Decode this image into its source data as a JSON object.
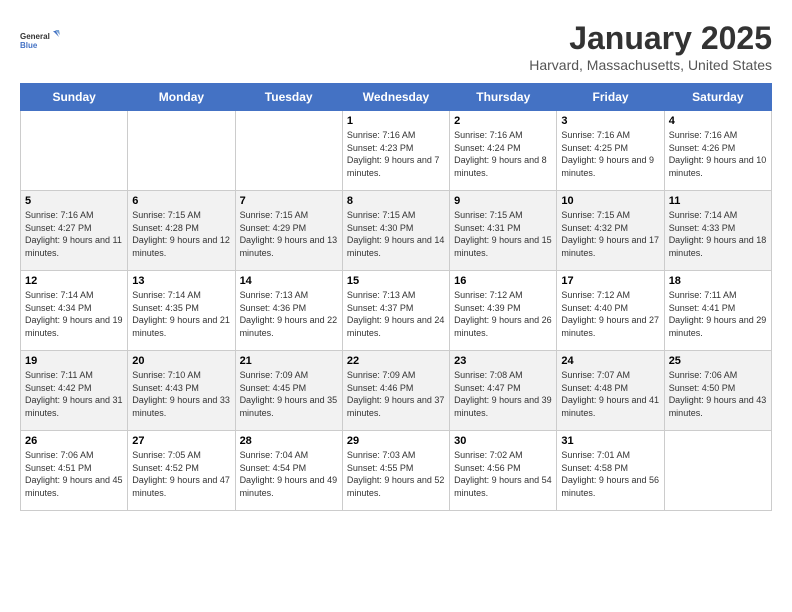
{
  "header": {
    "logo_line1": "General",
    "logo_line2": "Blue",
    "month_title": "January 2025",
    "location": "Harvard, Massachusetts, United States"
  },
  "days_of_week": [
    "Sunday",
    "Monday",
    "Tuesday",
    "Wednesday",
    "Thursday",
    "Friday",
    "Saturday"
  ],
  "weeks": [
    [
      {
        "day": "",
        "info": ""
      },
      {
        "day": "",
        "info": ""
      },
      {
        "day": "",
        "info": ""
      },
      {
        "day": "1",
        "info": "Sunrise: 7:16 AM\nSunset: 4:23 PM\nDaylight: 9 hours and 7 minutes."
      },
      {
        "day": "2",
        "info": "Sunrise: 7:16 AM\nSunset: 4:24 PM\nDaylight: 9 hours and 8 minutes."
      },
      {
        "day": "3",
        "info": "Sunrise: 7:16 AM\nSunset: 4:25 PM\nDaylight: 9 hours and 9 minutes."
      },
      {
        "day": "4",
        "info": "Sunrise: 7:16 AM\nSunset: 4:26 PM\nDaylight: 9 hours and 10 minutes."
      }
    ],
    [
      {
        "day": "5",
        "info": "Sunrise: 7:16 AM\nSunset: 4:27 PM\nDaylight: 9 hours and 11 minutes."
      },
      {
        "day": "6",
        "info": "Sunrise: 7:15 AM\nSunset: 4:28 PM\nDaylight: 9 hours and 12 minutes."
      },
      {
        "day": "7",
        "info": "Sunrise: 7:15 AM\nSunset: 4:29 PM\nDaylight: 9 hours and 13 minutes."
      },
      {
        "day": "8",
        "info": "Sunrise: 7:15 AM\nSunset: 4:30 PM\nDaylight: 9 hours and 14 minutes."
      },
      {
        "day": "9",
        "info": "Sunrise: 7:15 AM\nSunset: 4:31 PM\nDaylight: 9 hours and 15 minutes."
      },
      {
        "day": "10",
        "info": "Sunrise: 7:15 AM\nSunset: 4:32 PM\nDaylight: 9 hours and 17 minutes."
      },
      {
        "day": "11",
        "info": "Sunrise: 7:14 AM\nSunset: 4:33 PM\nDaylight: 9 hours and 18 minutes."
      }
    ],
    [
      {
        "day": "12",
        "info": "Sunrise: 7:14 AM\nSunset: 4:34 PM\nDaylight: 9 hours and 19 minutes."
      },
      {
        "day": "13",
        "info": "Sunrise: 7:14 AM\nSunset: 4:35 PM\nDaylight: 9 hours and 21 minutes."
      },
      {
        "day": "14",
        "info": "Sunrise: 7:13 AM\nSunset: 4:36 PM\nDaylight: 9 hours and 22 minutes."
      },
      {
        "day": "15",
        "info": "Sunrise: 7:13 AM\nSunset: 4:37 PM\nDaylight: 9 hours and 24 minutes."
      },
      {
        "day": "16",
        "info": "Sunrise: 7:12 AM\nSunset: 4:39 PM\nDaylight: 9 hours and 26 minutes."
      },
      {
        "day": "17",
        "info": "Sunrise: 7:12 AM\nSunset: 4:40 PM\nDaylight: 9 hours and 27 minutes."
      },
      {
        "day": "18",
        "info": "Sunrise: 7:11 AM\nSunset: 4:41 PM\nDaylight: 9 hours and 29 minutes."
      }
    ],
    [
      {
        "day": "19",
        "info": "Sunrise: 7:11 AM\nSunset: 4:42 PM\nDaylight: 9 hours and 31 minutes."
      },
      {
        "day": "20",
        "info": "Sunrise: 7:10 AM\nSunset: 4:43 PM\nDaylight: 9 hours and 33 minutes."
      },
      {
        "day": "21",
        "info": "Sunrise: 7:09 AM\nSunset: 4:45 PM\nDaylight: 9 hours and 35 minutes."
      },
      {
        "day": "22",
        "info": "Sunrise: 7:09 AM\nSunset: 4:46 PM\nDaylight: 9 hours and 37 minutes."
      },
      {
        "day": "23",
        "info": "Sunrise: 7:08 AM\nSunset: 4:47 PM\nDaylight: 9 hours and 39 minutes."
      },
      {
        "day": "24",
        "info": "Sunrise: 7:07 AM\nSunset: 4:48 PM\nDaylight: 9 hours and 41 minutes."
      },
      {
        "day": "25",
        "info": "Sunrise: 7:06 AM\nSunset: 4:50 PM\nDaylight: 9 hours and 43 minutes."
      }
    ],
    [
      {
        "day": "26",
        "info": "Sunrise: 7:06 AM\nSunset: 4:51 PM\nDaylight: 9 hours and 45 minutes."
      },
      {
        "day": "27",
        "info": "Sunrise: 7:05 AM\nSunset: 4:52 PM\nDaylight: 9 hours and 47 minutes."
      },
      {
        "day": "28",
        "info": "Sunrise: 7:04 AM\nSunset: 4:54 PM\nDaylight: 9 hours and 49 minutes."
      },
      {
        "day": "29",
        "info": "Sunrise: 7:03 AM\nSunset: 4:55 PM\nDaylight: 9 hours and 52 minutes."
      },
      {
        "day": "30",
        "info": "Sunrise: 7:02 AM\nSunset: 4:56 PM\nDaylight: 9 hours and 54 minutes."
      },
      {
        "day": "31",
        "info": "Sunrise: 7:01 AM\nSunset: 4:58 PM\nDaylight: 9 hours and 56 minutes."
      },
      {
        "day": "",
        "info": ""
      }
    ]
  ]
}
